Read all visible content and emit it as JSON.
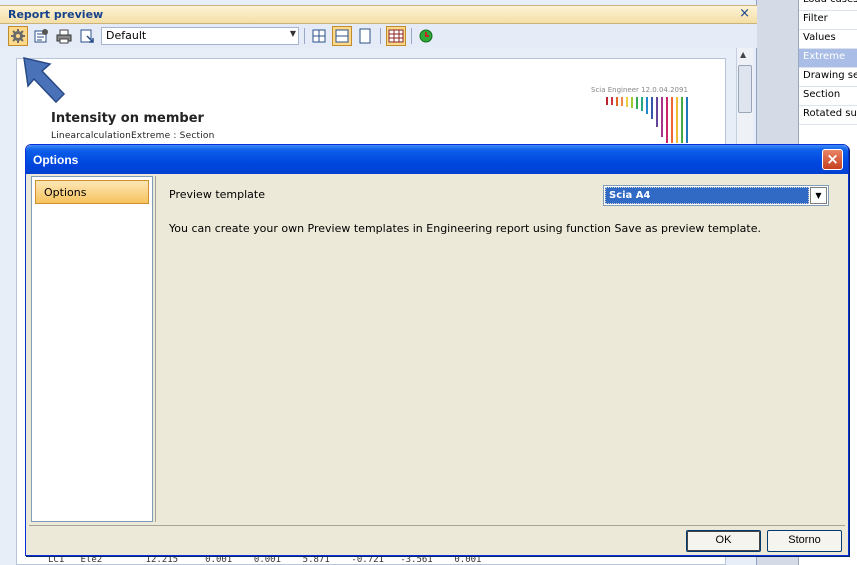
{
  "report_preview": {
    "title": "Report preview",
    "close_glyph": "×",
    "template_dropdown_value": "Default",
    "page": {
      "heading": "Intensity on member",
      "subheading": "LinearcalculationExtreme : Section",
      "logo_text": "Scia Engineer 12.0.04.2091",
      "bottom_row": "LC1   Ele2        12.215     0.001    0.001    5.871    -0.721   -3.561    0.001"
    },
    "toolbar_icons": [
      "settings-icon",
      "page-setup-icon",
      "print-icon",
      "export-icon",
      "zoom-width-icon",
      "zoom-page-icon",
      "single-page-icon",
      "table-icon",
      "refresh-icon"
    ]
  },
  "property_panel": {
    "rows": [
      {
        "label": "Load cases",
        "selected": false
      },
      {
        "label": "Filter",
        "selected": false
      },
      {
        "label": "Values",
        "selected": false
      },
      {
        "label": "Extreme",
        "selected": true
      },
      {
        "label": "Drawing se",
        "selected": false
      },
      {
        "label": "Section",
        "selected": false
      },
      {
        "label": "Rotated su",
        "selected": false
      }
    ]
  },
  "options_dialog": {
    "title": "Options",
    "close_glyph": "×",
    "nav_items": [
      "Options"
    ],
    "preview_template_label": "Preview template",
    "preview_template_value": "Scia A4",
    "info_text": "You can create your own Preview templates in Engineering report using function Save as preview template.",
    "ok_label": "OK",
    "storno_label": "Storno"
  },
  "colors": {
    "dialog_titlebar": "#0048e0",
    "selected_nav": "#f7c35e",
    "selected_option": "#316ac5"
  }
}
